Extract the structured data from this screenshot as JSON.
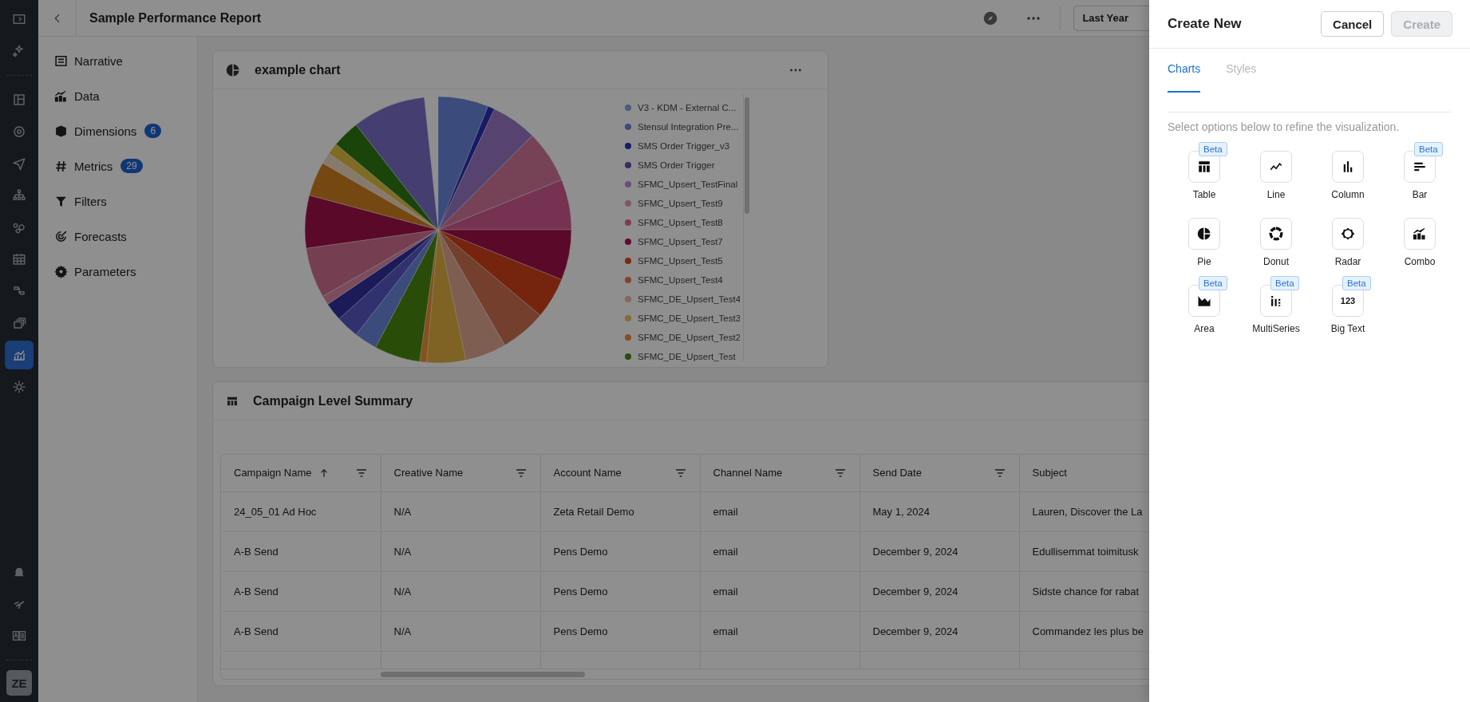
{
  "rail": {
    "items": [
      {
        "selected": false
      },
      {
        "selected": false
      },
      {
        "selected": false
      },
      {
        "selected": false
      },
      {
        "selected": false
      },
      {
        "selected": false
      },
      {
        "selected": false
      },
      {
        "selected": false
      },
      {
        "selected": false
      },
      {
        "selected": false
      },
      {
        "selected": true
      },
      {
        "selected": false
      }
    ],
    "avatar": "ZE"
  },
  "topbar": {
    "title": "Sample Performance Report",
    "date_range": "Last Year"
  },
  "sidebar": {
    "items": [
      {
        "kind": "narrative",
        "label": "Narrative"
      },
      {
        "kind": "data",
        "label": "Data"
      },
      {
        "kind": "dimensions",
        "label": "Dimensions",
        "badge": "6"
      },
      {
        "kind": "metrics",
        "label": "Metrics",
        "badge": "29"
      },
      {
        "kind": "filters",
        "label": "Filters"
      },
      {
        "kind": "forecasts",
        "label": "Forecasts"
      },
      {
        "kind": "parameters",
        "label": "Parameters"
      }
    ]
  },
  "chart_card": {
    "title": "example chart",
    "legend": [
      {
        "label": "V3 - KDM - External C...",
        "color": "#475e7d"
      },
      {
        "label": "Stensul Integration Pre...",
        "color": "#3b4b7b"
      },
      {
        "label": "SMS Order Trigger_v3",
        "color": "#171a67"
      },
      {
        "label": "SMS Order Trigger",
        "color": "#3c2c62"
      },
      {
        "label": "SFMC_Upsert_TestFinal",
        "color": "#65507d"
      },
      {
        "label": "SFMC_Upsert_Test9",
        "color": "#82566b"
      },
      {
        "label": "SFMC_Upsert_Test8",
        "color": "#7d3b59"
      },
      {
        "label": "SFMC_Upsert_Test7",
        "color": "#620932"
      },
      {
        "label": "SFMC_Upsert_Test5",
        "color": "#7d290f"
      },
      {
        "label": "SFMC_Upsert_Test4",
        "color": "#7d432d"
      },
      {
        "label": "SFMC_DE_Upsert_Test4",
        "color": "#866759"
      },
      {
        "label": "SFMC_DE_Upsert_Test3",
        "color": "#866b36"
      },
      {
        "label": "SFMC_DE_Upsert_Test2",
        "color": "#86501b"
      },
      {
        "label": "SFMC_DE_Upsert_Test",
        "color": "#294d09"
      }
    ]
  },
  "table_card": {
    "title": "Campaign Level Summary",
    "columns": [
      {
        "label": "Campaign Name",
        "sorted_ascending": true,
        "filter": true
      },
      {
        "label": "Creative Name",
        "sorted_ascending": false,
        "filter": true
      },
      {
        "label": "Account Name",
        "sorted_ascending": false,
        "filter": true
      },
      {
        "label": "Channel Name",
        "sorted_ascending": false,
        "filter": true
      },
      {
        "label": "Send Date",
        "sorted_ascending": false,
        "filter": true
      },
      {
        "label": "Subject",
        "sorted_ascending": false,
        "filter": false
      }
    ],
    "rows": [
      [
        "24_05_01 Ad Hoc",
        "N/A",
        "Zeta Retail Demo",
        "email",
        "May 1, 2024",
        "Lauren, Discover the La"
      ],
      [
        "A-B Send",
        "N/A",
        "Pens Demo",
        "email",
        "December 9, 2024",
        "Edullisemmat toimitusk"
      ],
      [
        "A-B Send",
        "N/A",
        "Pens Demo",
        "email",
        "December 9, 2024",
        "Sidste chance for rabat"
      ],
      [
        "A-B Send",
        "N/A",
        "Pens Demo",
        "email",
        "December 9, 2024",
        "Commandez les plus be"
      ]
    ]
  },
  "panel": {
    "title": "Create New",
    "buttons": [
      {
        "label": "Cancel",
        "disabled": false
      },
      {
        "label": "Create",
        "disabled": true
      }
    ],
    "tabs": [
      {
        "label": "Charts",
        "selected": true
      },
      {
        "label": "Styles",
        "selected": false
      }
    ],
    "help": "Select options below to refine the visualization.",
    "options": [
      {
        "kind": "table",
        "label": "Table",
        "badge": "Beta"
      },
      {
        "kind": "line",
        "label": "Line"
      },
      {
        "kind": "column",
        "label": "Column"
      },
      {
        "kind": "bar",
        "label": "Bar",
        "badge": "Beta"
      },
      {
        "kind": "pie",
        "label": "Pie"
      },
      {
        "kind": "donut",
        "label": "Donut"
      },
      {
        "kind": "radar",
        "label": "Radar"
      },
      {
        "kind": "combo",
        "label": "Combo"
      },
      {
        "kind": "area",
        "label": "Area",
        "badge": "Beta"
      },
      {
        "kind": "multiseries",
        "label": "MultiSeries",
        "badge": "Beta"
      },
      {
        "kind": "bigtext",
        "label": "Big Text",
        "badge": "Beta",
        "icon_text": "123"
      }
    ]
  }
}
